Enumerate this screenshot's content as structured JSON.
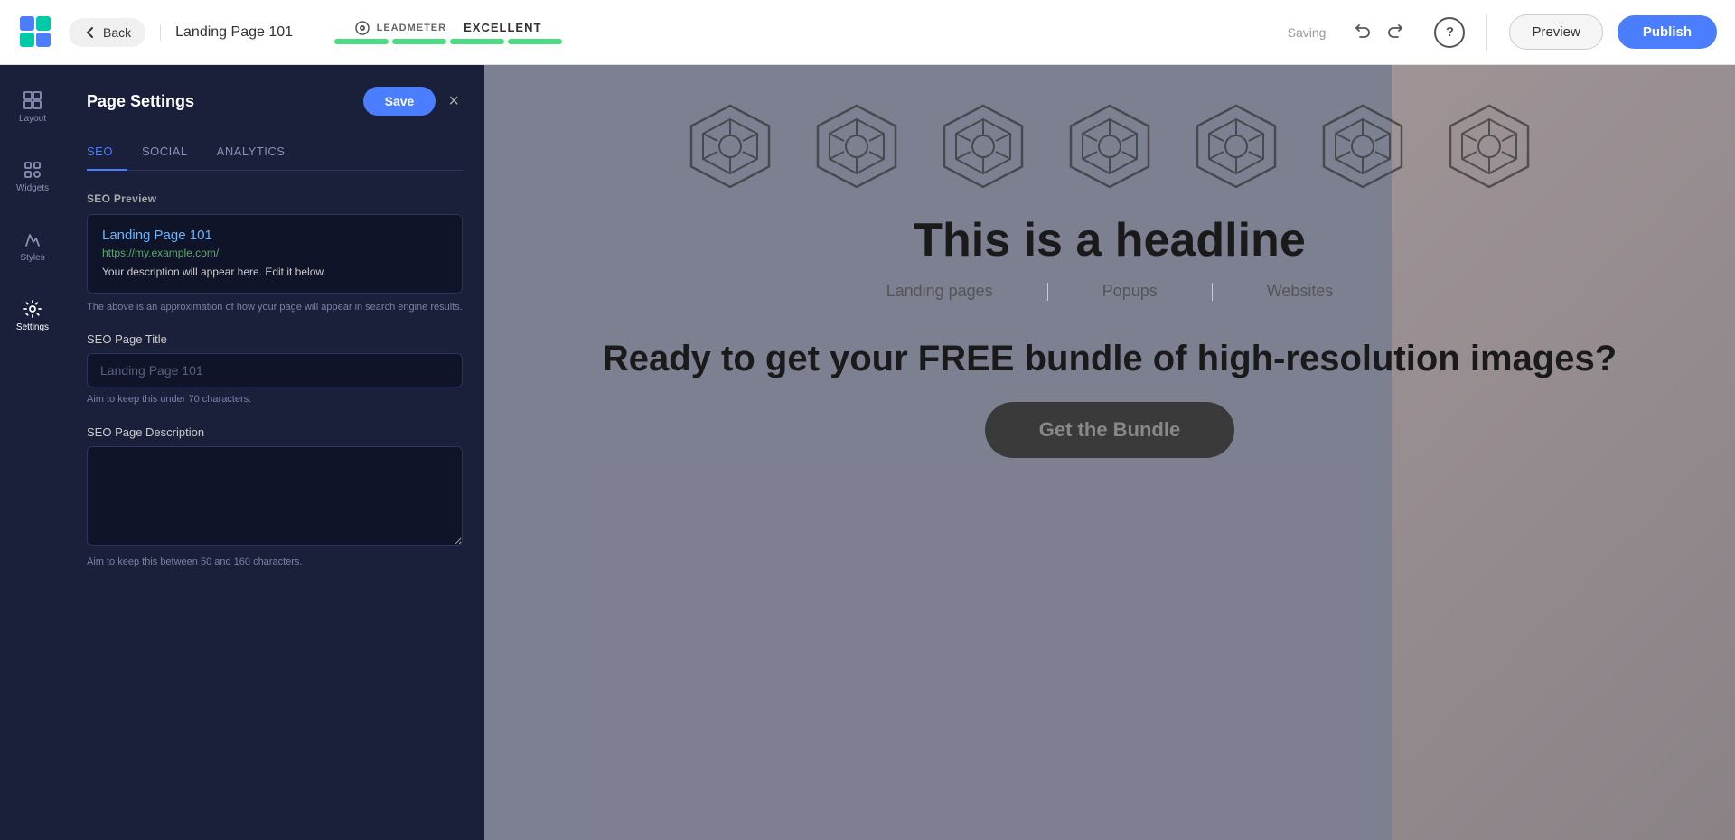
{
  "topbar": {
    "logo_alt": "App Logo",
    "back_label": "Back",
    "page_title": "Landing Page 101",
    "leadmeter_label": "LEADMETER",
    "leadmeter_score": "EXCELLENT",
    "saving_text": "Saving",
    "undo_label": "Undo",
    "redo_label": "Redo",
    "help_label": "?",
    "preview_label": "Preview",
    "publish_label": "Publish"
  },
  "sidebar": {
    "items": [
      {
        "id": "layout",
        "label": "Layout"
      },
      {
        "id": "widgets",
        "label": "Widgets"
      },
      {
        "id": "styles",
        "label": "Styles"
      },
      {
        "id": "settings",
        "label": "Settings"
      }
    ]
  },
  "panel": {
    "title": "Page Settings",
    "save_label": "Save",
    "close_label": "×",
    "tabs": [
      {
        "id": "seo",
        "label": "SEO",
        "active": true
      },
      {
        "id": "social",
        "label": "SOCIAL",
        "active": false
      },
      {
        "id": "analytics",
        "label": "ANALYTICS",
        "active": false
      }
    ],
    "seo_preview_section_label": "SEO Preview",
    "seo_preview": {
      "title": "Landing Page 101",
      "url": "https://my.example.com/",
      "description": "Your description will appear here. Edit it below."
    },
    "seo_preview_hint": "The above is an approximation of how your page will appear in search engine results.",
    "seo_title_label": "SEO Page Title",
    "seo_title_placeholder": "Landing Page 101",
    "seo_title_hint": "Aim to keep this under 70 characters.",
    "seo_desc_label": "SEO Page Description",
    "seo_desc_placeholder": "",
    "seo_desc_hint": "Aim to keep this between 50 and 160 characters."
  },
  "canvas": {
    "headline": "This is a headline",
    "categories": [
      "Landing pages",
      "Popups",
      "Websites"
    ],
    "cta_headline": "Ready to get your FREE bundle of high-resolution images?",
    "cta_button_label": "Get the Bundle"
  },
  "icons": {
    "hex_count": 7
  }
}
